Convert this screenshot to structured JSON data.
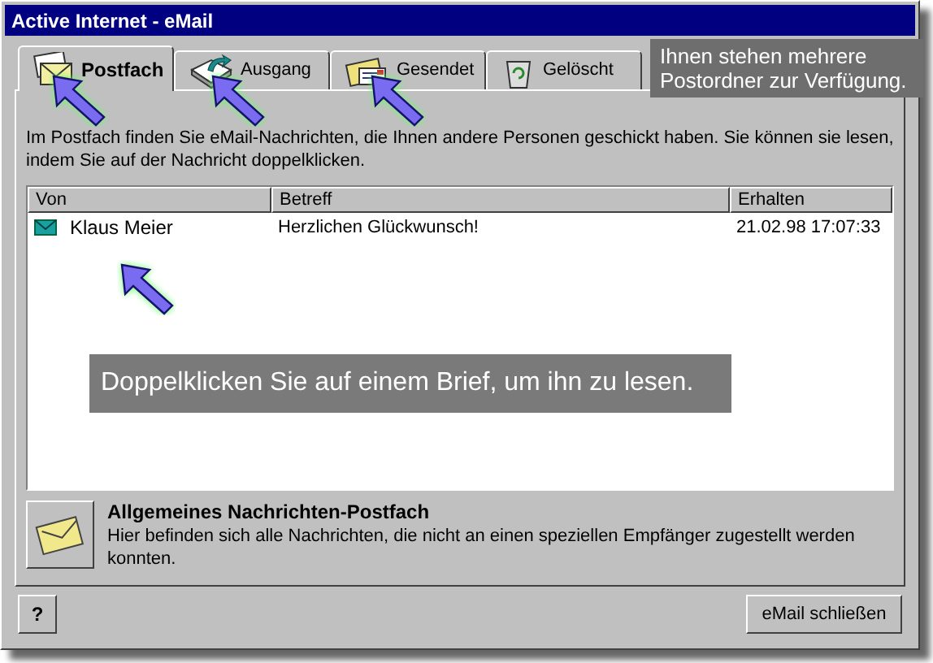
{
  "window": {
    "title": "Active Internet - eMail"
  },
  "tabs": [
    {
      "label": "Postfach",
      "kind": "inbox",
      "selected": true
    },
    {
      "label": "Ausgang",
      "kind": "outbox",
      "selected": false
    },
    {
      "label": "Gesendet",
      "kind": "sent",
      "selected": false
    },
    {
      "label": "Gelöscht",
      "kind": "trash",
      "selected": false
    }
  ],
  "description": "Im Postfach finden Sie eMail-Nachrichten, die Ihnen andere Personen geschickt haben. Sie können sie lesen, indem Sie auf der Nachricht doppelklicken.",
  "table": {
    "columns": [
      "Von",
      "Betreff",
      "Erhalten"
    ],
    "rows": [
      {
        "from": "Klaus Meier",
        "subject": "Herzlichen Glückwunsch!",
        "received": "21.02.98 17:07:33"
      }
    ]
  },
  "folder_info": {
    "title": "Allgemeines Nachrichten-Postfach",
    "text": "Hier befinden sich alle Nachrichten, die nicht an einen speziellen Empfänger zugestellt werden konnten."
  },
  "buttons": {
    "help": "?",
    "close": "eMail schließen"
  },
  "callouts": [
    "Ihnen stehen mehrere Postordner zur Verfügung.",
    "Doppelklicken Sie auf einem Brief, um ihn zu lesen."
  ]
}
